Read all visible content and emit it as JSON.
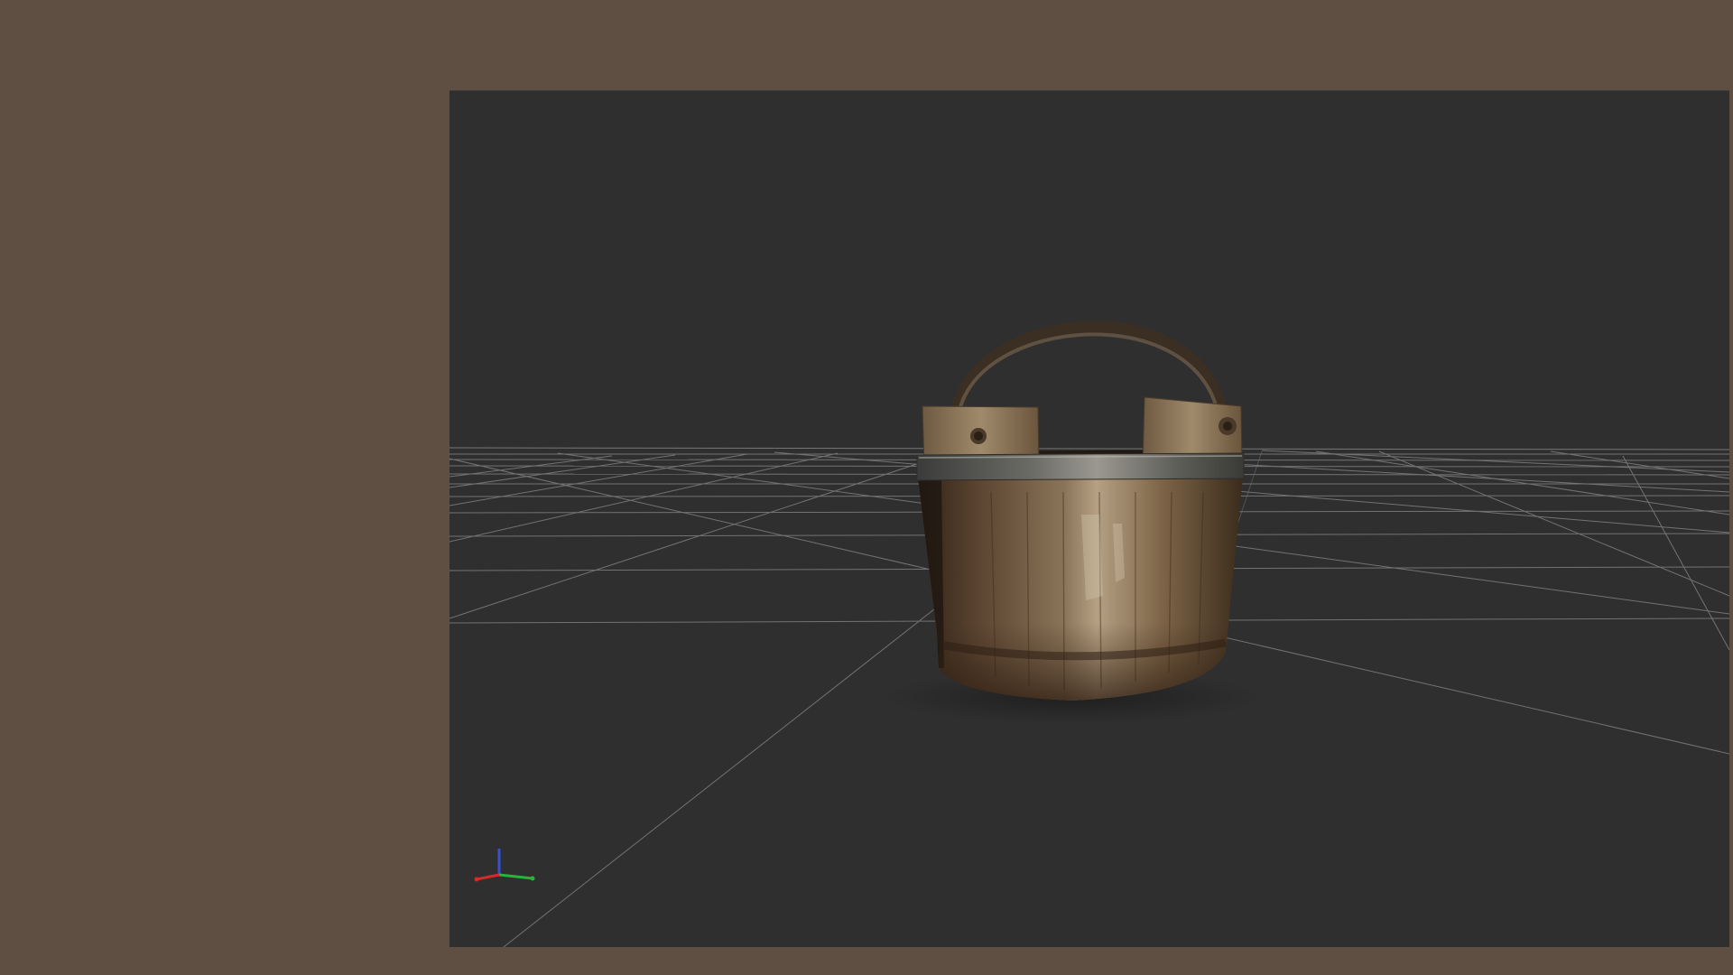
{
  "window": {
    "background_color": "#5f4f42"
  },
  "viewport": {
    "background_color": "#2f2f2f",
    "grid_color": "#8a8a8a",
    "scene_object": "wooden-bucket",
    "gizmo": {
      "axes": [
        {
          "name": "x",
          "color": "#d42a2a"
        },
        {
          "name": "y",
          "color": "#2ab33a"
        },
        {
          "name": "z",
          "color": "#3a4fd6"
        }
      ]
    }
  }
}
